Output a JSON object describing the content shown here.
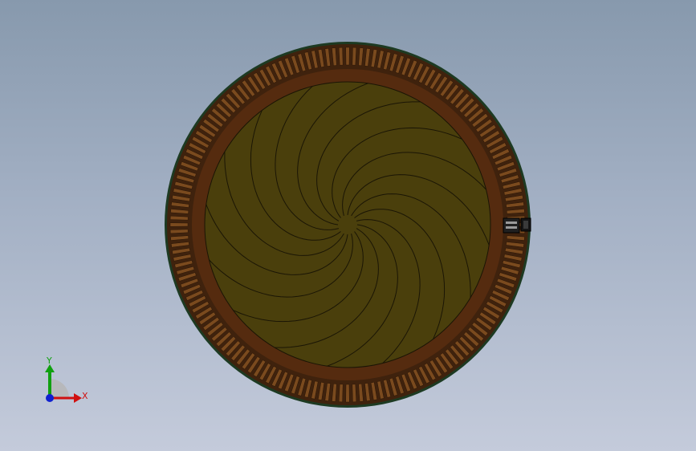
{
  "viewport": {
    "background_top": "#8799ad",
    "background_bottom": "#c4cbdb"
  },
  "model": {
    "outer_ring_color": "#3f220d",
    "slot_color": "#7a4a1e",
    "inner_band_color": "#552b0f",
    "blade_face_color": "#4a3f0c",
    "blade_edge_color": "#1a1505",
    "rim_edge_color": "#1d3a22",
    "blade_count": 16,
    "slot_count": 160,
    "connector_icon": "connector-icon"
  },
  "triad": {
    "x_label": "X",
    "y_label": "Y",
    "x_color": "#d01010",
    "y_color": "#10a010",
    "z_color": "#1020d0"
  }
}
